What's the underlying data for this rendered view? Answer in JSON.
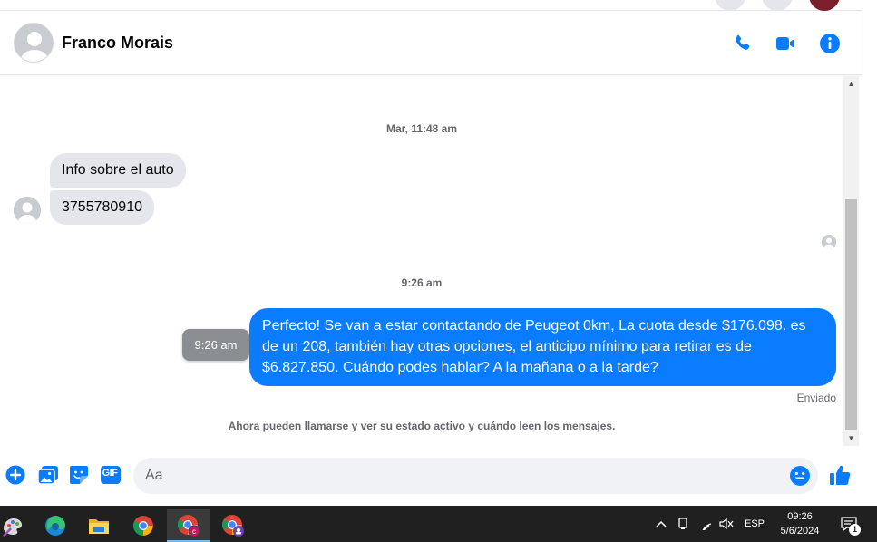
{
  "header": {
    "contact_name": "Franco Morais",
    "icons": [
      "phone-icon",
      "video-icon",
      "info-icon"
    ],
    "accent_color": "#0a7cff"
  },
  "chat": {
    "separator_1": "Mar, 11:48 am",
    "incoming_1": "Info sobre el auto",
    "incoming_2": "3755780910",
    "separator_2": "9:26 am",
    "outgoing_1": "Perfecto!  Se van a estar contactando de Peugeot 0km, La cuota desde $176.098. es de un 208, también hay otras opciones, el anticipo mínimo para retirar es de $6.827.850. Cuándo podes hablar? A la mañana o a la tarde?",
    "tooltip_time": "9:26 am",
    "status": "Enviado",
    "notice": "Ahora pueden llamarse y ver su estado activo y cuándo leen los mensajes.",
    "outgoing_bubble_color": "#0a7cff",
    "incoming_bubble_color": "#e4e6eb"
  },
  "composer": {
    "placeholder": "Aa",
    "value": "",
    "gif_label": "GIF",
    "icons": [
      "plus-icon",
      "image-icon",
      "sticker-icon",
      "gif-icon",
      "emoji-icon",
      "like-icon"
    ]
  },
  "taskbar": {
    "apps": [
      "paint-icon",
      "edge-icon",
      "file-explorer-icon",
      "chrome-icon",
      "chrome-profile-icon",
      "chrome-incognito-icon"
    ],
    "tray_language": "ESP",
    "time": "09:26",
    "date": "5/6/2024",
    "notification_count": "1"
  }
}
